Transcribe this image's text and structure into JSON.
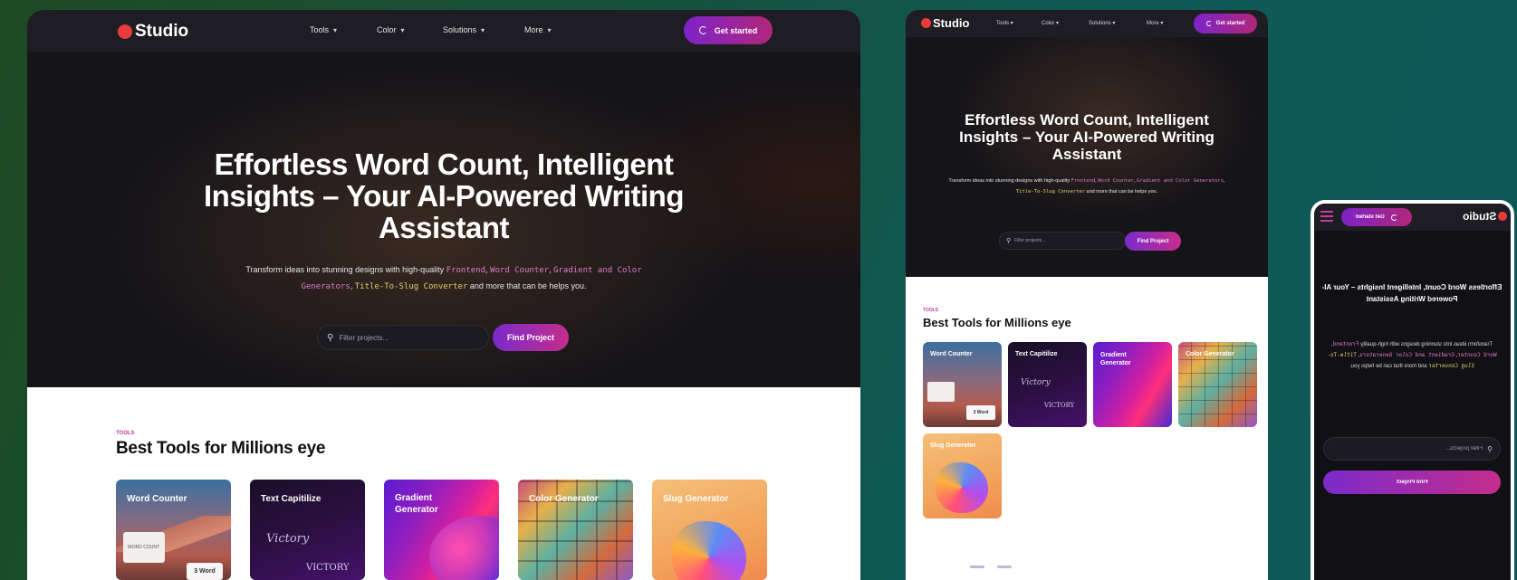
{
  "brand": {
    "name": "Studio",
    "accent": "#ea3b3b",
    "gradient_start": "#7d23c8",
    "gradient_end": "#c42d8c"
  },
  "nav": {
    "items": [
      "Tools",
      "Color",
      "Solutions",
      "More"
    ],
    "cta_label": "Get started"
  },
  "hero": {
    "title": "Effortless Word Count, Intelligent Insights – Your AI-Powered Writing Assistant",
    "sub_prefix": "Transform ideas into stunning designs with high-quality",
    "code_1": "Frontend",
    "code_2": "Word Counter",
    "code_3": "Gradient and Color Generators",
    "code_4": "Title-To-Slug Converter",
    "sub_suffix": "and more that can be helps you.",
    "search_placeholder": "Filter projects...",
    "find_button": "Find Project"
  },
  "tools": {
    "eyebrow": "TOOLS",
    "title": "Best Tools for Millions eye",
    "cards": [
      {
        "label": "Word Counter",
        "icon": "mountain-scene",
        "badge_small": "WORD COUNT",
        "badge": "3 Word"
      },
      {
        "label": "Text Capitilize",
        "icon": "text-script",
        "word_1": "Victory",
        "word_2": "VICTORY"
      },
      {
        "label": "Gradient Generator",
        "icon": "gradient-waves"
      },
      {
        "label": "Color Generator",
        "icon": "color-mosaic"
      },
      {
        "label": "Slug Generator",
        "icon": "blob-shape"
      }
    ]
  },
  "colors": {
    "hero_bg": "#151419",
    "nav_bg": "#1e1d23",
    "page_bg_from": "#1d4a22",
    "page_bg_to": "#0e5858"
  }
}
